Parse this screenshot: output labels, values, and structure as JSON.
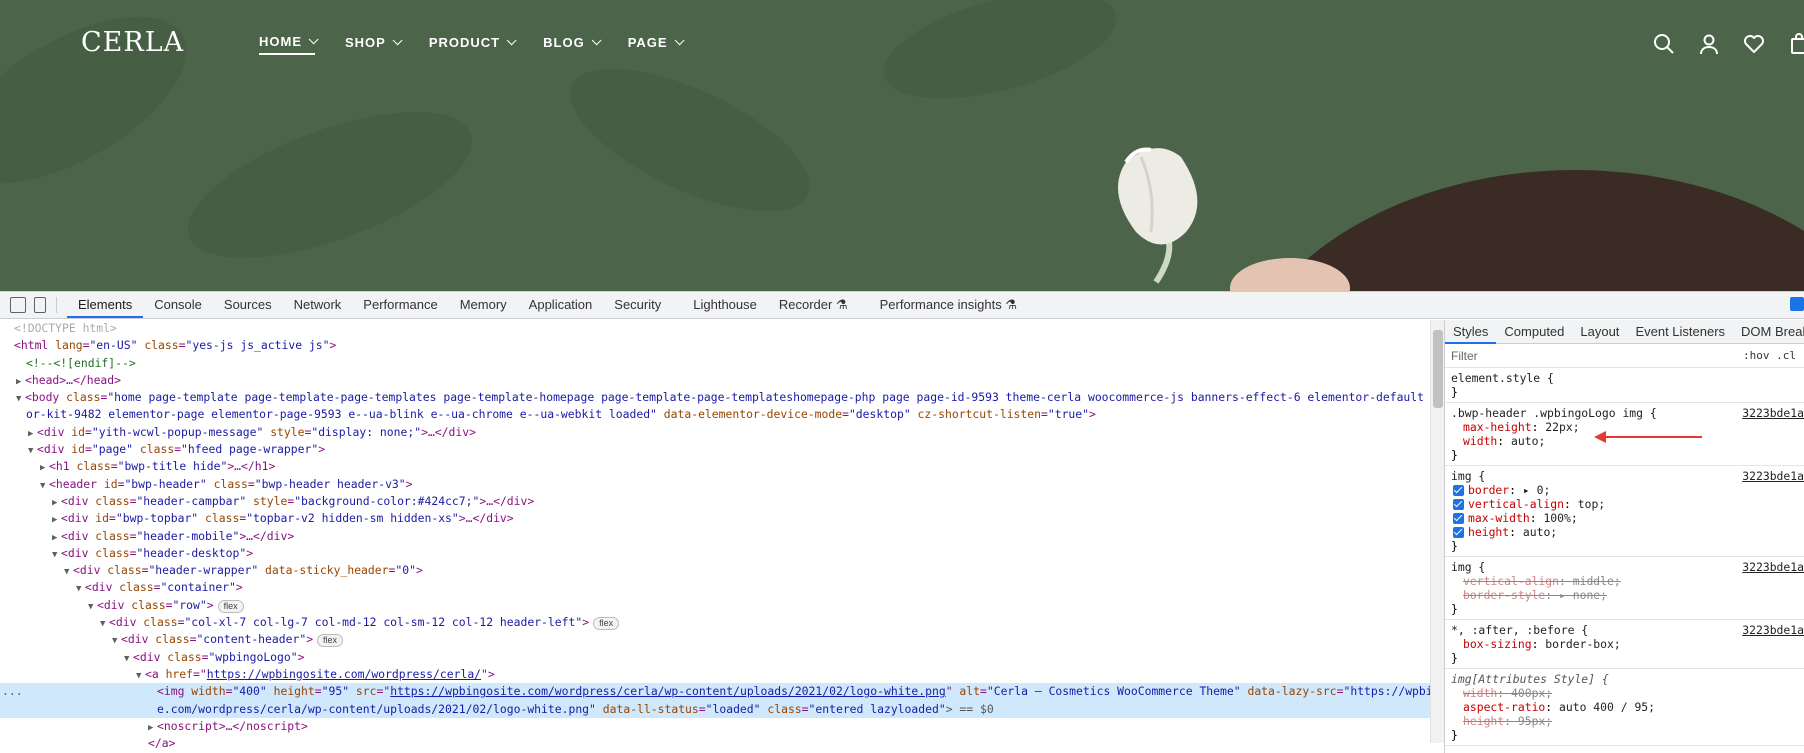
{
  "site": {
    "logo": "CERLA",
    "nav": [
      {
        "label": "HOME",
        "active": true
      },
      {
        "label": "SHOP",
        "active": false
      },
      {
        "label": "PRODUCT",
        "active": false
      },
      {
        "label": "BLOG",
        "active": false
      },
      {
        "label": "PAGE",
        "active": false
      }
    ],
    "icons": [
      "search-icon",
      "user-icon",
      "heart-icon",
      "cart-icon"
    ],
    "bg_color": "#4c654a"
  },
  "devtools": {
    "tabs": [
      "Elements",
      "Console",
      "Sources",
      "Network",
      "Performance",
      "Memory",
      "Application",
      "Security",
      "Lighthouse",
      "Recorder ⚗",
      "Performance insights ⚗"
    ],
    "active_tab": "Elements",
    "dom": {
      "l1": "<!DOCTYPE html>",
      "l2_tag": "<html ",
      "l2_a1": "lang",
      "l2_v1": "\"en-US\"",
      "l2_a2": "class",
      "l2_v2": "\"yes-js js_active js\"",
      "l2_end": ">",
      "l3": "<!--<![endif]-->",
      "l4": "<head>…</head>",
      "l5_tag": "<body ",
      "l5_a1": "class",
      "l5_v1": "\"home page-template page-template-page-templates page-template-homepage page-template-page-templateshomepage-php page page-id-9593 theme-cerla woocommerce-js banners-effect-6 elementor-default element",
      "l6_v1": "or-kit-9482 elementor-page elementor-page-9593 e--ua-blink e--ua-chrome e--ua-webkit loaded\"",
      "l6_a2": "data-elementor-device-mode",
      "l6_v2": "\"desktop\"",
      "l6_a3": "cz-shortcut-listen",
      "l6_v3": "\"true\"",
      "l6_end": ">",
      "l7_tag": "<div ",
      "l7_a1": "id",
      "l7_v1": "\"yith-wcwl-popup-message\"",
      "l7_a2": "style",
      "l7_v2": "\"display: none;\"",
      "l7_end": ">…</div>",
      "l8_tag": "<div ",
      "l8_a1": "id",
      "l8_v1": "\"page\"",
      "l8_a2": "class",
      "l8_v2": "\"hfeed page-wrapper\"",
      "l8_end": ">",
      "l9_tag": "<h1 ",
      "l9_a1": "class",
      "l9_v1": "\"bwp-title hide\"",
      "l9_end": ">…</h1>",
      "l10_tag": "<header ",
      "l10_a1": "id",
      "l10_v1": "\"bwp-header\"",
      "l10_a2": "class",
      "l10_v2": "\"bwp-header header-v3\"",
      "l10_end": ">",
      "l11_tag": "<div ",
      "l11_a1": "class",
      "l11_v1": "\"header-campbar\"",
      "l11_a2": "style",
      "l11_v2": "\"background-color:#424cc7;\"",
      "l11_end": ">…</div>",
      "l12_tag": "<div ",
      "l12_a1": "id",
      "l12_v1": "\"bwp-topbar\"",
      "l12_a2": "class",
      "l12_v2": "\"topbar-v2 hidden-sm hidden-xs\"",
      "l12_end": ">…</div>",
      "l13_tag": "<div ",
      "l13_a1": "class",
      "l13_v1": "\"header-mobile\"",
      "l13_end": ">…</div>",
      "l14_tag": "<div ",
      "l14_a1": "class",
      "l14_v1": "\"header-desktop\"",
      "l14_end": ">",
      "l15_tag": "<div ",
      "l15_a1": "class",
      "l15_v1": "\"header-wrapper\"",
      "l15_a2": "data-sticky_header",
      "l15_v2": "\"0\"",
      "l15_end": ">",
      "l16_tag": "<div ",
      "l16_a1": "class",
      "l16_v1": "\"container\"",
      "l16_end": ">",
      "l17_tag": "<div ",
      "l17_a1": "class",
      "l17_v1": "\"row\"",
      "l17_end": ">",
      "l18_tag": "<div ",
      "l18_a1": "class",
      "l18_v1": "\"col-xl-7 col-lg-7 col-md-12 col-sm-12 col-12 header-left\"",
      "l18_end": ">",
      "l19_tag": "<div ",
      "l19_a1": "class",
      "l19_v1": "\"content-header\"",
      "l19_end": ">",
      "l20_tag": "<div ",
      "l20_a1": "class",
      "l20_v1": "\"wpbingoLogo\"",
      "l20_end": ">",
      "l21_tag": "<a ",
      "l21_a1": "href",
      "l21_v1": "https://wpbingosite.com/wordpress/cerla/",
      "l21_end": ">",
      "l22_tag": "<img ",
      "l22_a1": "width",
      "l22_v1": "\"400\"",
      "l22_a2": "height",
      "l22_v2": "\"95\"",
      "l22_a3": "src",
      "l22_v3": "https://wpbingosite.com/wordpress/cerla/wp-content/uploads/2021/02/logo-white.png",
      "l22_a4": "alt",
      "l22_v4": "\"Cerla – Cosmetics WooCommerce Theme\"",
      "l22_a5": "data-lazy-src",
      "l22_v5": "\"https://wpbingosit",
      "l23_v5": "e.com/wordpress/cerla/wp-content/uploads/2021/02/logo-white.png\"",
      "l23_a6": "data-ll-status",
      "l23_v6": "\"loaded\"",
      "l23_a7": "class",
      "l23_v7": "\"entered lazyloaded\"",
      "l23_end": "> == $0",
      "l24": "<noscript>…</noscript>",
      "l25": "</a>",
      "flex": "flex",
      "dots": "..."
    },
    "styles": {
      "tabs": [
        "Styles",
        "Computed",
        "Layout",
        "Event Listeners",
        "DOM Breakpo"
      ],
      "active_tab": "Styles",
      "filter_placeholder": "Filter",
      "hov": ":hov .cl",
      "element_style": "element.style {",
      "close": "}",
      "r1_sel": ".bwp-header .wpbingoLogo img {",
      "r1_src": "3223bde1a",
      "r1_p1n": "max-height",
      "r1_p1v": "22px;",
      "r1_p2n": "width",
      "r1_p2v": "auto;",
      "r2_sel": "img {",
      "r2_src": "3223bde1a",
      "r2_p1n": "border",
      "r2_p1v": "▸ 0;",
      "r2_p2n": "vertical-align",
      "r2_p2v": "top;",
      "r2_p3n": "max-width",
      "r2_p3v": "100%;",
      "r2_p4n": "height",
      "r2_p4v": "auto;",
      "r3_sel": "img {",
      "r3_src": "3223bde1a",
      "r3_p1n": "vertical-align",
      "r3_p1v": "middle;",
      "r3_p2n": "border-style",
      "r3_p2v": "▸ none;",
      "r4_sel": "*, :after, :before {",
      "r4_src": "3223bde1a",
      "r4_p1n": "box-sizing",
      "r4_p1v": "border-box;",
      "r5_sel": "img[Attributes Style] {",
      "r5_p1n": "width",
      "r5_p1v": "400px;",
      "r5_p2n": "aspect-ratio",
      "r5_p2v": "auto 400 / 95;",
      "r5_p3n": "height",
      "r5_p3v": "95px;"
    },
    "colors": {
      "accent": "#1a73e8",
      "annotation_arrow": "#e53935"
    }
  }
}
